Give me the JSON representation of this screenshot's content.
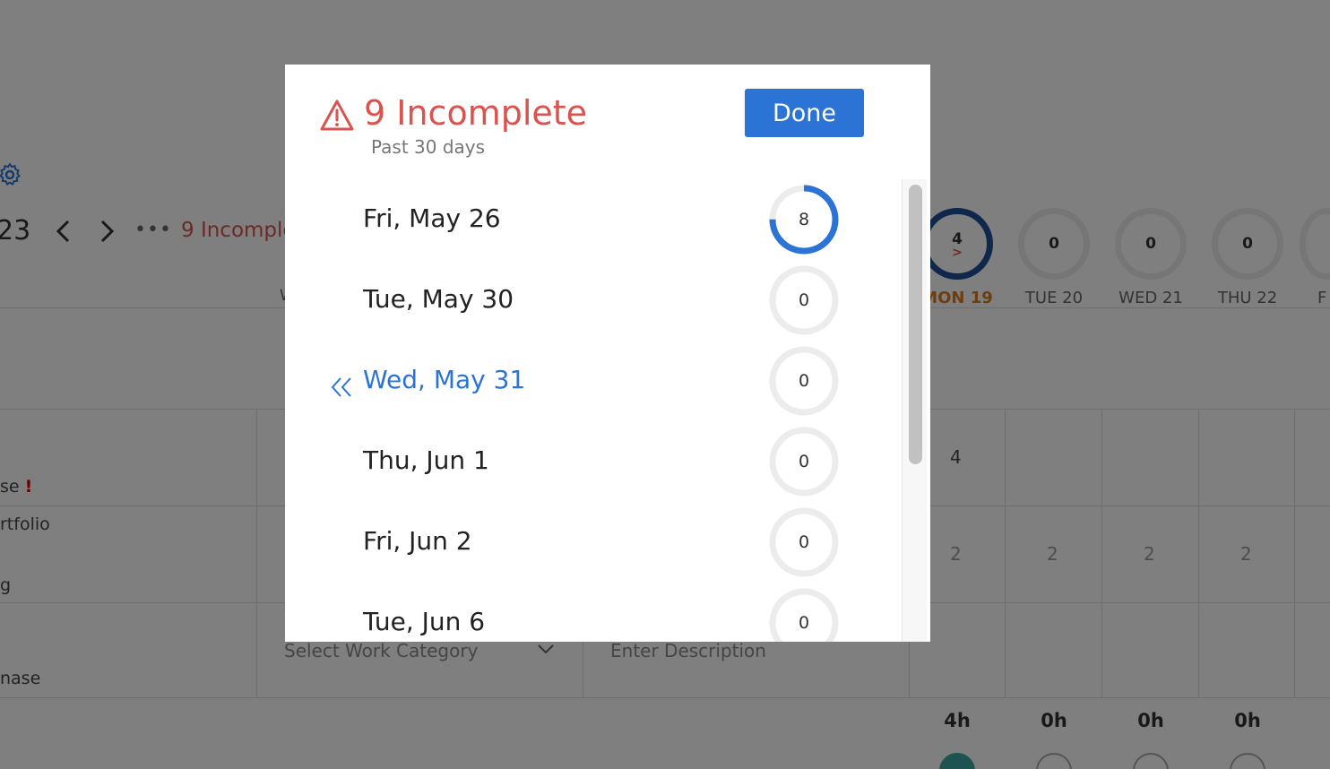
{
  "background": {
    "year_fragment": "23",
    "incomplete_link": "9 Incomple",
    "days": [
      {
        "count": "4",
        "label": "MON 19",
        "today": true,
        "status_mark": ">"
      },
      {
        "count": "0",
        "label": "TUE 20"
      },
      {
        "count": "0",
        "label": "WED 21"
      },
      {
        "count": "0",
        "label": "THU 22"
      },
      {
        "label": "F"
      }
    ],
    "row1": {
      "side_label": "se",
      "alert_mark": "!",
      "col_fragment": "W",
      "mon_value": "4"
    },
    "row2": {
      "side_label_a": "rtfolio",
      "side_label_b": "g",
      "values": [
        "2",
        "2",
        "2",
        "2"
      ]
    },
    "row3": {
      "side_label": "nase",
      "category_placeholder": "Select Work Category",
      "description_placeholder": "Enter Description"
    },
    "hours": [
      "4h",
      "0h",
      "0h",
      "0h"
    ]
  },
  "modal": {
    "title": "9 Incomplete",
    "subtitle": "Past 30 days",
    "done_label": "Done",
    "colors": {
      "accent": "#2b74d6",
      "alert": "#d9534f",
      "ring_track": "#ececec"
    },
    "days": [
      {
        "label": "Fri, May 26",
        "count": "8",
        "progress": 0.75,
        "current": false
      },
      {
        "label": "Tue, May 30",
        "count": "0",
        "progress": 0,
        "current": false
      },
      {
        "label": "Wed, May 31",
        "count": "0",
        "progress": 0,
        "current": true
      },
      {
        "label": "Thu, Jun 1",
        "count": "0",
        "progress": 0,
        "current": false
      },
      {
        "label": "Fri, Jun 2",
        "count": "0",
        "progress": 0,
        "current": false
      },
      {
        "label": "Tue, Jun 6",
        "count": "0",
        "progress": 0,
        "current": false
      }
    ]
  }
}
